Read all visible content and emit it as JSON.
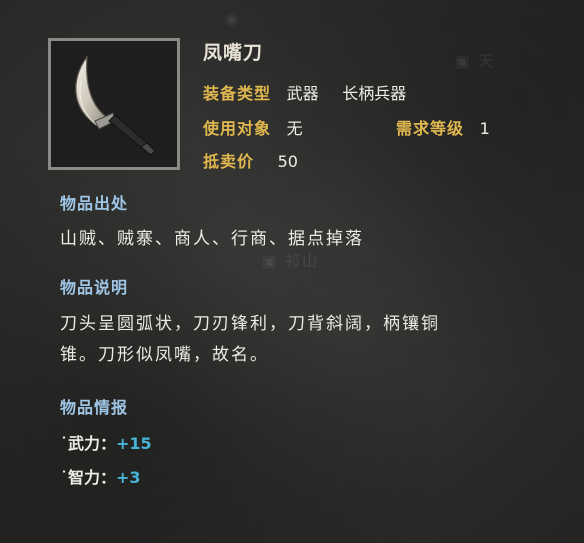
{
  "item": {
    "name": "凤嘴刀",
    "icon": "crescent-blade-icon"
  },
  "attributes": {
    "equip_type_label": "装备类型",
    "equip_type_value": "武器",
    "equip_subtype_value": "长柄兵器",
    "user_label": "使用对象",
    "user_value": "无",
    "req_level_label": "需求等级",
    "req_level_value": "1",
    "price_label": "抵卖价",
    "price_value": "50"
  },
  "source": {
    "title": "物品出处",
    "text": "山贼、贼寨、商人、行商、据点掉落"
  },
  "description": {
    "title": "物品说明",
    "line1": "刀头呈圆弧状，刀刃锋利，刀背斜阔，柄镶铜",
    "line2": "锥。刀形似凤嘴，故名。"
  },
  "intel": {
    "title": "物品情报",
    "stats": [
      {
        "label": "˙武力：",
        "value": "+15"
      },
      {
        "label": "˙智力：",
        "value": "+3"
      }
    ]
  },
  "colors": {
    "gold_label": "#e0b84f",
    "section_title": "#9fc6e6",
    "stat_value": "#47b4d6"
  }
}
